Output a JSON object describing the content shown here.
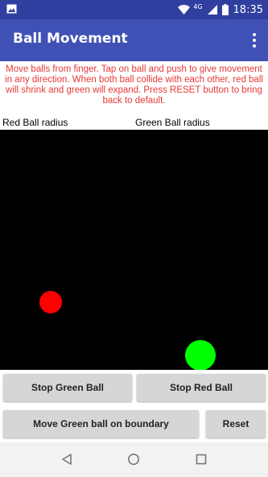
{
  "status_bar": {
    "network_label": "4G",
    "time": "18:35",
    "icons": [
      "image-icon",
      "wifi-icon",
      "signal-icon",
      "battery-icon"
    ]
  },
  "app_bar": {
    "title": "Ball Movement",
    "menu_icon": "overflow-menu-icon"
  },
  "instructions": "Move balls from finger. Tap on ball and push to give movement in any direction. When both ball collide with each other, red ball will shrink and green will expand. Press RESET button to bring back to default.",
  "radius_labels": {
    "red": "Red Ball radius",
    "green": "Green Ball radius"
  },
  "balls": {
    "red_color": "#ff0000",
    "green_color": "#00ff00"
  },
  "buttons": {
    "stop_green": "Stop Green Ball",
    "stop_red": "Stop Red Ball",
    "move_green_boundary": "Move Green ball on boundary",
    "reset": "Reset"
  },
  "nav_bar": {
    "icons": [
      "back-icon",
      "home-icon",
      "recents-icon"
    ]
  },
  "colors": {
    "status_bar": "#303f9f",
    "app_bar": "#3f51b5",
    "instruction_text": "#e53935",
    "canvas": "#000000",
    "button": "#d6d6d6"
  }
}
